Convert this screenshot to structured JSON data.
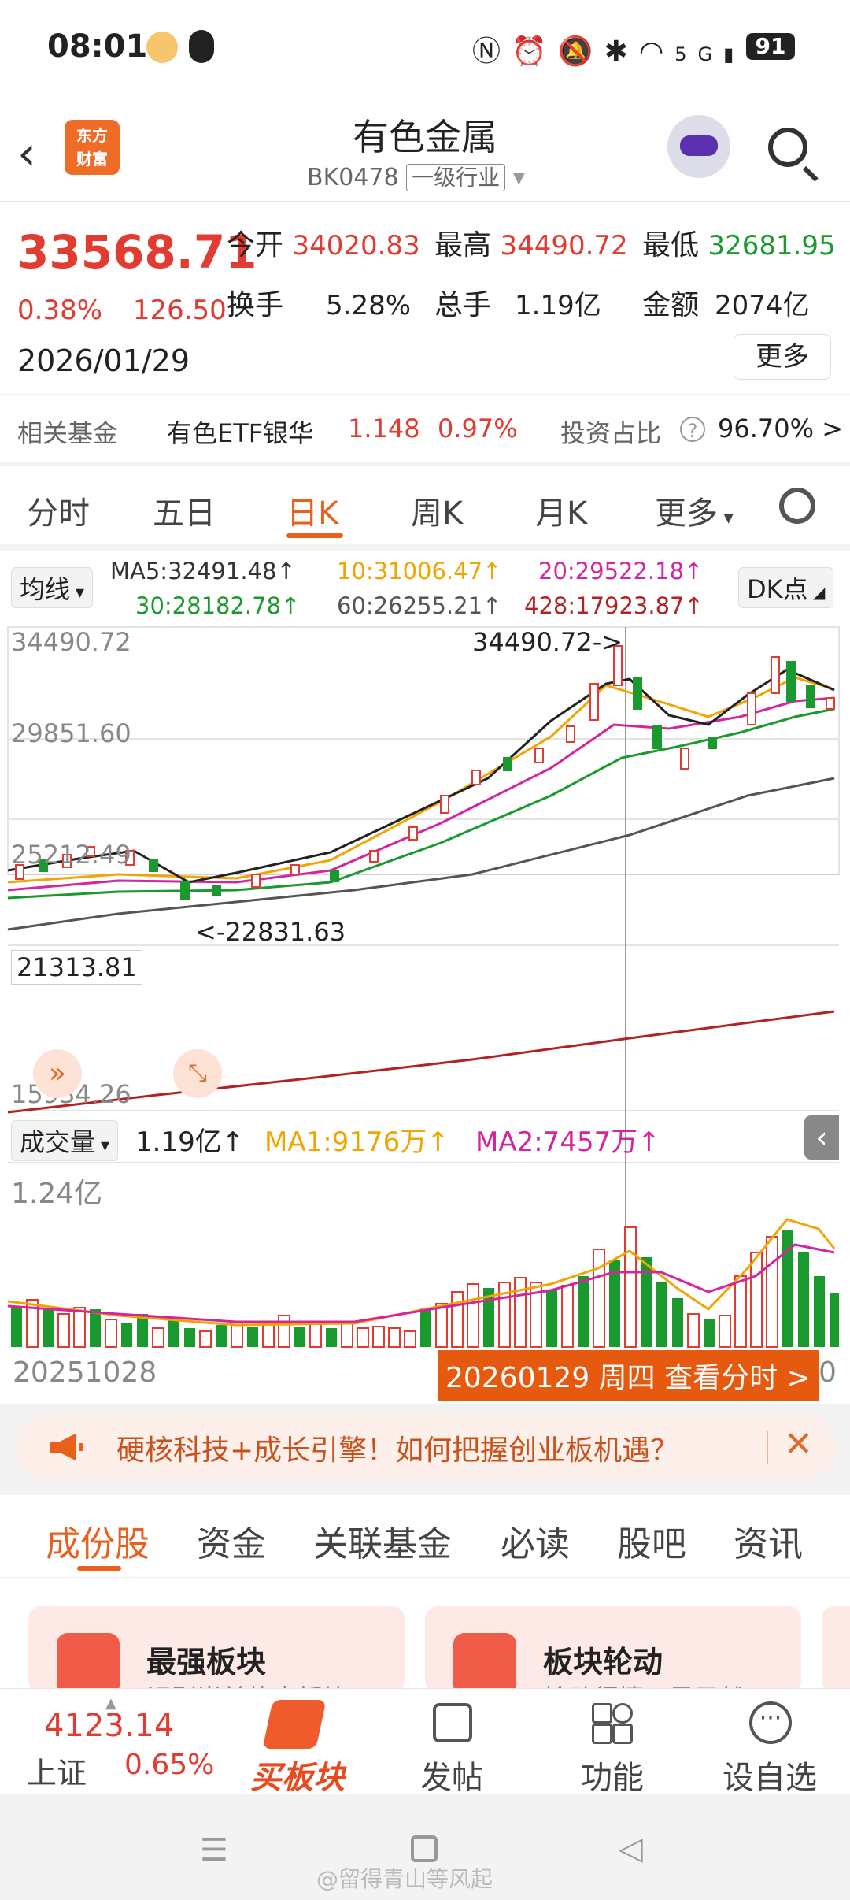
{
  "status": {
    "time": "08:01",
    "battery": "91",
    "net": "5G"
  },
  "header": {
    "title": "有色金属",
    "code": "BK0478",
    "industry_tag": "一级行业",
    "logo_line1": "东方",
    "logo_line2": "财富"
  },
  "quote": {
    "price": "33568.71",
    "pct": "0.38%",
    "change": "126.50",
    "date": "2026/01/29",
    "open_label": "今开",
    "open": "34020.83",
    "high_label": "最高",
    "high": "34490.72",
    "low_label": "最低",
    "low": "32681.95",
    "turnover_label": "换手",
    "turnover": "5.28%",
    "volume_label": "总手",
    "volume": "1.19亿",
    "amount_label": "金额",
    "amount": "2074亿",
    "more": "更多"
  },
  "fund": {
    "label": "相关基金",
    "name": "有色ETF银华",
    "price": "1.148",
    "pct": "0.97%",
    "ratio_label": "投资占比",
    "ratio": "96.70% >"
  },
  "tabs": [
    "分时",
    "五日",
    "日K",
    "周K",
    "月K",
    "更多"
  ],
  "ma": {
    "selector": "均线",
    "ma5": "MA5:32491.48↑",
    "ma10": "10:31006.47↑",
    "ma20": "20:29522.18↑",
    "ma30": "30:28182.78↑",
    "ma60": "60:26255.21↑",
    "ma428": "428:17923.87↑",
    "dk": "DK点"
  },
  "chart": {
    "y_labels": [
      "34490.72",
      "29851.60",
      "25212.49",
      "21313.81",
      "15934.26"
    ],
    "high_marker": "34490.72->",
    "low_marker": "<-22831.63",
    "vol_selector": "成交量",
    "vol_value": "1.19亿↑",
    "vol_ma1": "MA1:9176万↑",
    "vol_ma2": "MA2:7457万↑",
    "vol_max": "1.24亿",
    "start_date": "20251028",
    "cursor_tip": "20260129 周四 查看分时 >",
    "end_char": "0",
    "colors": {
      "up": "#e23b31",
      "down": "#1a9a2e",
      "ma5": "#222222",
      "ma10": "#f0a500",
      "ma20": "#d6249f",
      "ma30": "#1a9a2e",
      "ma60": "#555555",
      "ma428": "#b22222"
    }
  },
  "banner": {
    "text": "硬核科技+成长引擎！如何把握创业板机遇？"
  },
  "section_tabs": [
    "成份股",
    "资金",
    "关联基金",
    "必读",
    "股吧",
    "资讯"
  ],
  "cards": [
    {
      "title": "最强板块",
      "sub": "识别当前热点板块"
    },
    {
      "title": "板块轮动",
      "sub": "轮动行情一目了然"
    }
  ],
  "bottom": {
    "index_value": "4123.14",
    "index_name": "上证",
    "index_pct": "0.65%",
    "buy": "买板块",
    "post": "发帖",
    "func": "功能",
    "watch": "设自选"
  },
  "watermark": "@留得青山等风起"
}
